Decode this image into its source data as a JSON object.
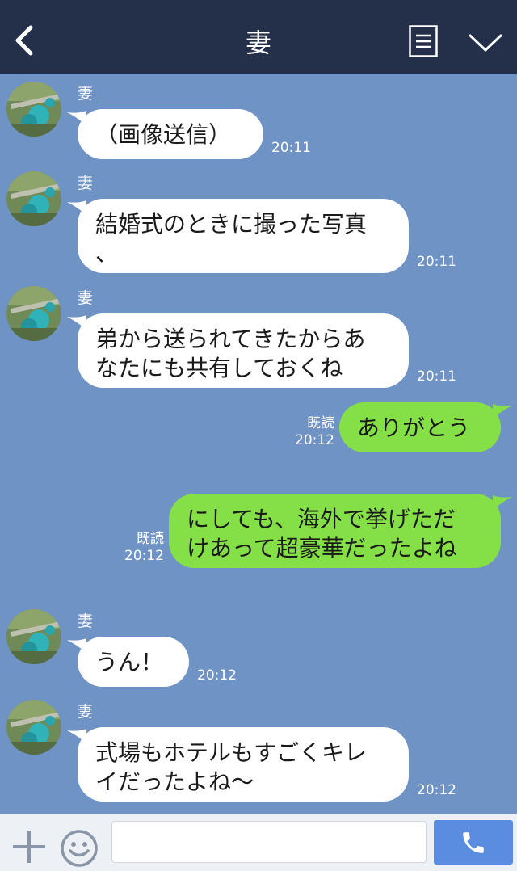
{
  "header": {
    "title": "妻",
    "back_icon": "chevron-left-icon",
    "menu_icon": "document-menu-icon",
    "collapse_icon": "chevron-down-icon"
  },
  "colors": {
    "header_bg": "#243049",
    "chat_bg": "#7093c6",
    "sent_bubble": "#84e046",
    "received_bubble": "#ffffff",
    "call_button": "#5a8de0"
  },
  "messages": [
    {
      "direction": "in",
      "sender": "妻",
      "lines": [
        "（画像送信）"
      ],
      "time": "20:11"
    },
    {
      "direction": "in",
      "sender": "妻",
      "lines": [
        "結婚式のときに撮った写真",
        "、"
      ],
      "time": "20:11"
    },
    {
      "direction": "in",
      "sender": "妻",
      "lines": [
        "弟から送られてきたからあ",
        "なたにも共有しておくね"
      ],
      "time": "20:11"
    },
    {
      "direction": "out",
      "lines": [
        "ありがとう"
      ],
      "read": "既読",
      "time": "20:12"
    },
    {
      "direction": "out",
      "lines": [
        "にしても、海外で挙げただ",
        "けあって超豪華だったよね"
      ],
      "read": "既読",
      "time": "20:12"
    },
    {
      "direction": "in",
      "sender": "妻",
      "lines": [
        "うん！"
      ],
      "time": "20:12"
    },
    {
      "direction": "in",
      "sender": "妻",
      "lines": [
        "式場もホテルもすごくキレ",
        "イだったよね〜"
      ],
      "time": "20:12"
    }
  ],
  "footer": {
    "plus_icon": "plus-icon",
    "emoji_icon": "smiley-icon",
    "input_value": "",
    "call_icon": "phone-icon"
  }
}
